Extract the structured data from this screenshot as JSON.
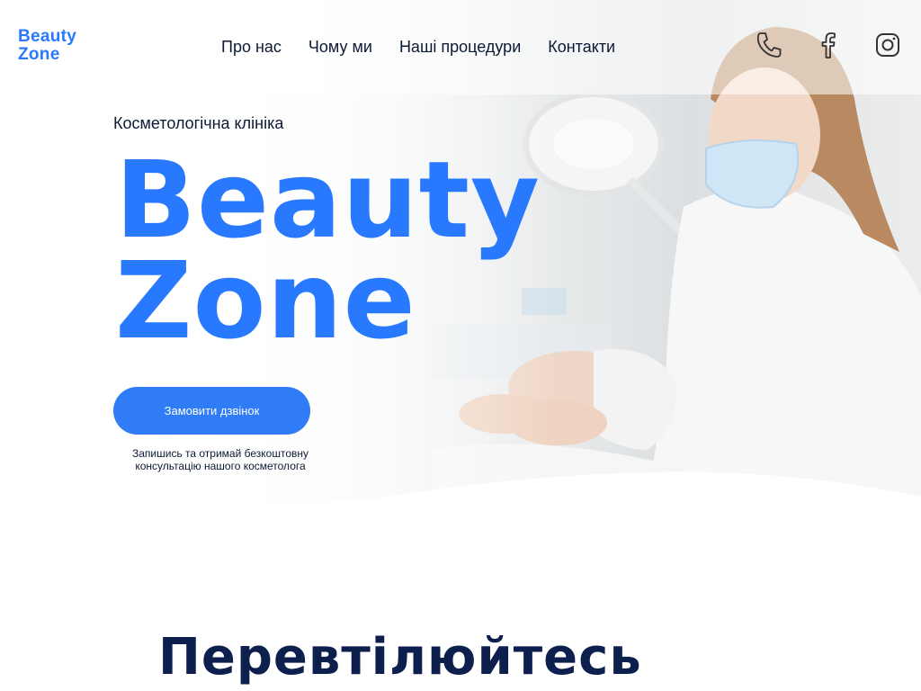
{
  "logo": {
    "line1": "Beauty",
    "line2": "Zone"
  },
  "nav": {
    "items": [
      {
        "label": "Про нас"
      },
      {
        "label": "Чому ми"
      },
      {
        "label": "Наші процедури"
      },
      {
        "label": "Контакти"
      }
    ]
  },
  "socials": {
    "phone_icon": "phone-icon",
    "facebook_icon": "facebook-icon",
    "instagram_icon": "instagram-icon"
  },
  "hero": {
    "subtitle": "Косметологічна клініка",
    "title_line1": "Beauty",
    "title_line2": "Zone",
    "cta_label": "Замовити дзвінок",
    "cta_note": "Запишись та отримай безкоштовну консультацію нашого косметолога"
  },
  "section": {
    "title": "Перевтілюйтесь"
  },
  "colors": {
    "accent": "#2979ff",
    "dark_text": "#0d1a33",
    "heading_dark": "#0d1f4d"
  }
}
